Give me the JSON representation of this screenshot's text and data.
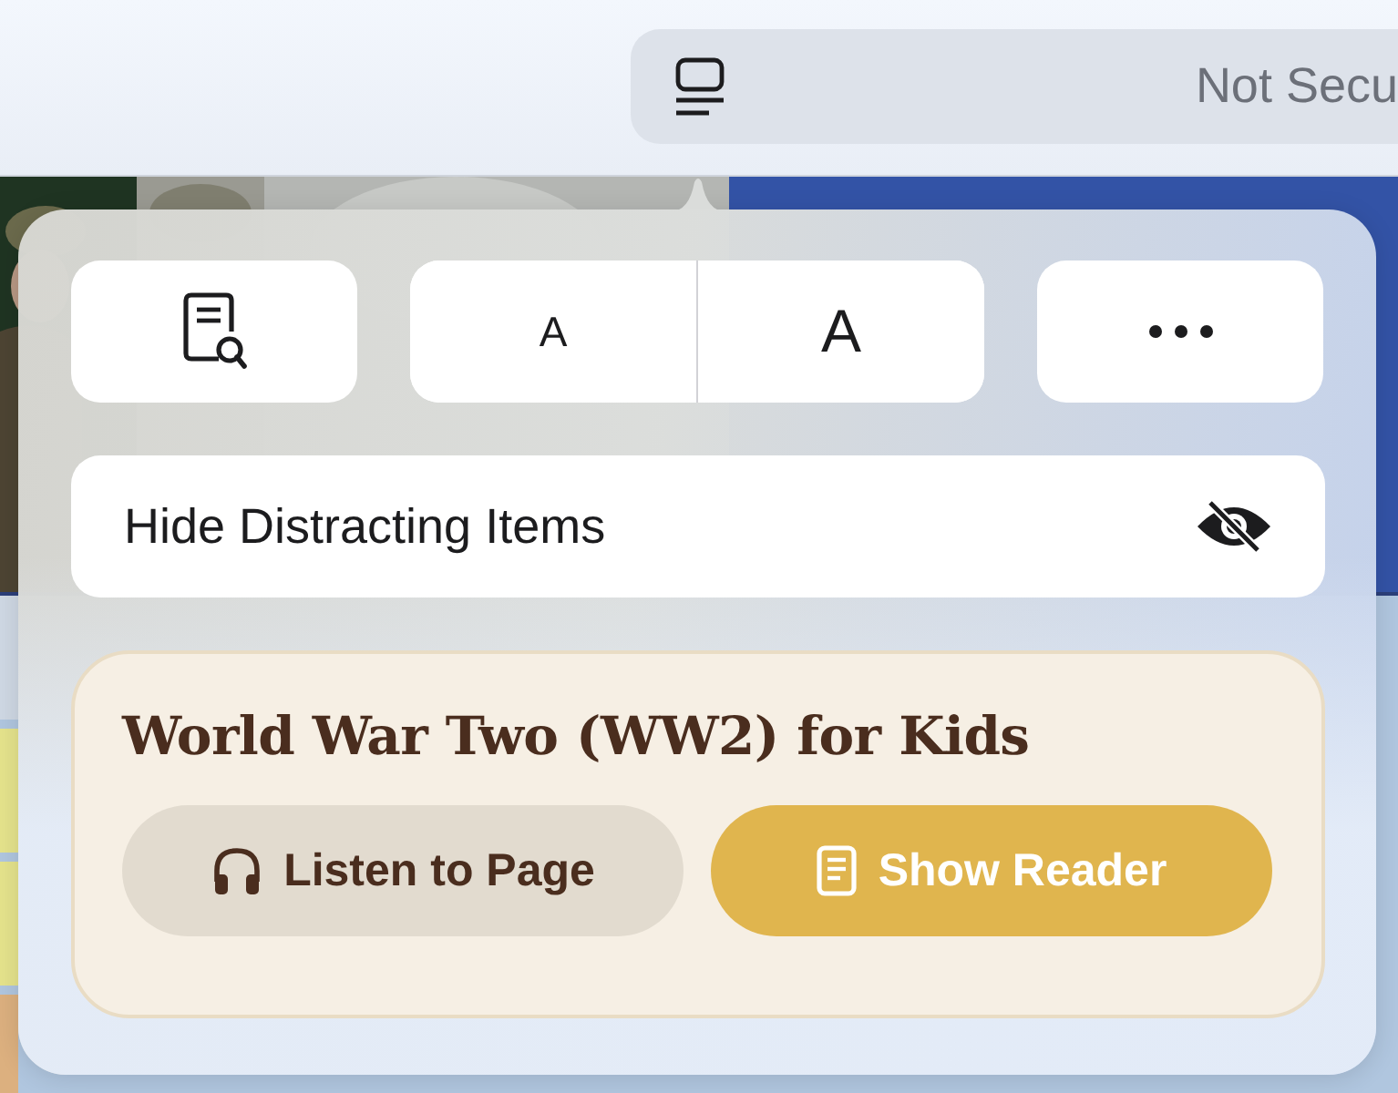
{
  "address_bar": {
    "security_label": "Not Secu"
  },
  "popover": {
    "font_size_buttons": [
      {
        "kind": "smaller",
        "label": "A"
      },
      {
        "kind": "larger",
        "label": "A"
      }
    ],
    "hide_distracting_items": {
      "label": "Hide Distracting Items"
    },
    "reader_card": {
      "title": "World War Two (WW2) for Kids",
      "buttons": [
        {
          "kind": "listen",
          "label": "Listen to Page"
        },
        {
          "kind": "reader",
          "label": "Show Reader"
        }
      ]
    }
  }
}
